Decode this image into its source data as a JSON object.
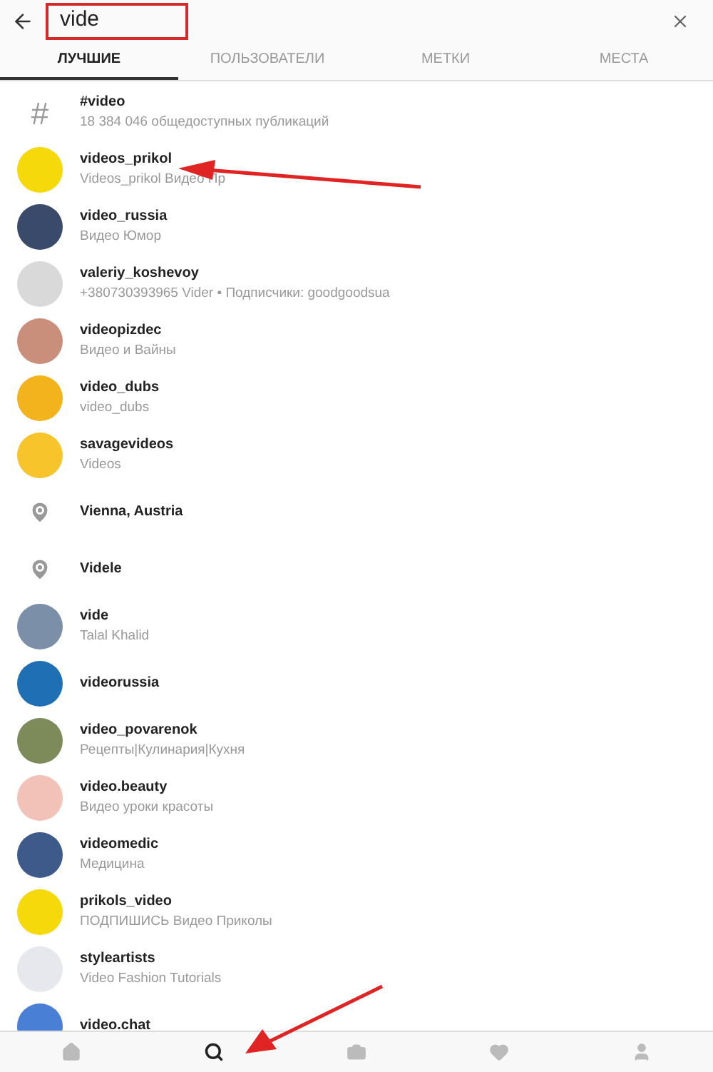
{
  "search": {
    "value": "vide"
  },
  "tabs": [
    {
      "label": "ЛУЧШИЕ",
      "selected": true
    },
    {
      "label": "ПОЛЬЗОВАТЕЛИ",
      "selected": false
    },
    {
      "label": "МЕТКИ",
      "selected": false
    },
    {
      "label": "МЕСТА",
      "selected": false
    }
  ],
  "results": [
    {
      "kind": "hashtag",
      "icon": "#",
      "title": "#video",
      "subtitle": "18 384 046 общедоступных публикаций"
    },
    {
      "kind": "user",
      "color": "#f5d90a",
      "title": "videos_prikol",
      "subtitle": "Videos_prikol Видео Пр"
    },
    {
      "kind": "user",
      "color": "#3a4a6b",
      "title": "video_russia",
      "subtitle": "Видео Юмор"
    },
    {
      "kind": "user",
      "color": "#d9d9d9",
      "title": "valeriy_koshevoy",
      "subtitle": "+380730393965 Vider • Подписчики: goodgoodsua"
    },
    {
      "kind": "user",
      "color": "#c98f7a",
      "title": "videopizdec",
      "subtitle": "Видео и Вайны"
    },
    {
      "kind": "user",
      "color": "#f2b31c",
      "title": "video_dubs",
      "subtitle": "video_dubs"
    },
    {
      "kind": "user",
      "color": "#f7c52b",
      "title": "savagevideos",
      "subtitle": "Videos"
    },
    {
      "kind": "place",
      "title": "Vienna, Austria"
    },
    {
      "kind": "place",
      "title": "Videle"
    },
    {
      "kind": "user",
      "color": "#7b8fa8",
      "title": "vide",
      "subtitle": "Talal Khalid"
    },
    {
      "kind": "user",
      "color": "#1f6fb5",
      "title": "videorussia"
    },
    {
      "kind": "user",
      "color": "#7d8a5a",
      "title": "video_povarenok",
      "subtitle": "Рецепты|Кулинария|Кухня"
    },
    {
      "kind": "user",
      "color": "#f2c2b8",
      "title": "video.beauty",
      "subtitle": "Видео уроки красоты"
    },
    {
      "kind": "user",
      "color": "#3d5a8a",
      "title": "videomedic",
      "subtitle": "Медицина"
    },
    {
      "kind": "user",
      "color": "#f5d90a",
      "title": "prikols_video",
      "subtitle": "ПОДПИШИСЬ Видео Приколы"
    },
    {
      "kind": "user",
      "color": "#e6e8ee",
      "title": "styleartists",
      "subtitle": "Video Fashion Tutorials"
    },
    {
      "kind": "user",
      "color": "#4a7fd6",
      "title": "video.chat"
    }
  ],
  "nav": [
    {
      "kind": "home",
      "selected": false
    },
    {
      "kind": "search",
      "selected": true
    },
    {
      "kind": "camera",
      "selected": false
    },
    {
      "kind": "heart",
      "selected": false
    },
    {
      "kind": "profile",
      "selected": false
    }
  ]
}
